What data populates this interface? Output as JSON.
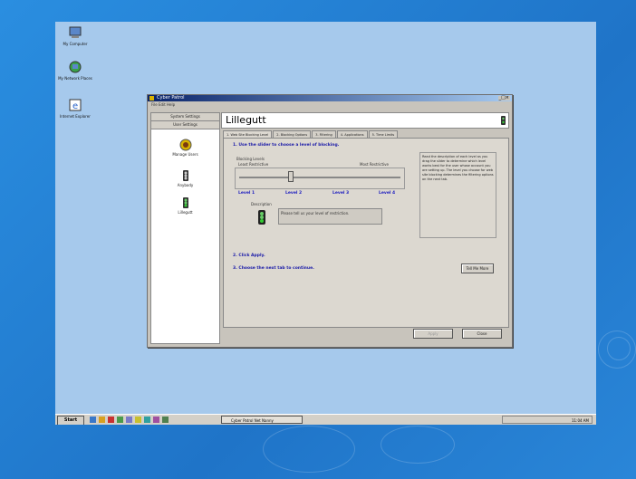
{
  "desktop": {
    "icons": [
      {
        "label": "My Computer",
        "icon": "computer-icon"
      },
      {
        "label": "My Network Places",
        "icon": "network-icon"
      },
      {
        "label": "Internet Explorer",
        "icon": "browser-icon"
      }
    ]
  },
  "window": {
    "title": "Cyber Patrol",
    "menu": "File  Edit  Help",
    "left_tabs": [
      "System Settings",
      "User Settings"
    ],
    "users": [
      {
        "label": "Manage Users",
        "icon": "manage-users-icon"
      },
      {
        "label": "Anybody",
        "icon": "traffic-light-icon"
      },
      {
        "label": "Lillegutt",
        "icon": "traffic-light-green-icon"
      }
    ],
    "selected_user": "Lillegutt",
    "tabs": [
      "1. Web Site Blocking Level",
      "2. Blocking Options",
      "3. Filtering",
      "4. Applications",
      "5. Time Limits"
    ],
    "content": {
      "step1": "1. Use the slider to choose a level of blocking.",
      "blocking_levels_label": "Blocking Levels",
      "least_restrictive": "Least Restrictive",
      "most_restrictive": "Most Restrictive",
      "levels": [
        "Level 1",
        "Level 2",
        "Level 3",
        "Level 4"
      ],
      "description_label": "Description",
      "description_text": "Please tell us your level of restriction.",
      "side_help": "Read the description of each level as you drag the slider to determine which level works best for the user whose account you are setting up. The level you choose for web site blocking determines the filtering options on the next tab.",
      "step2": "2. Click Apply.",
      "step3": "3. Choose the next tab to continue.",
      "tell_me_more": "Tell Me More"
    },
    "buttons": {
      "apply": "Apply",
      "close": "Close"
    }
  },
  "taskbar": {
    "start": "Start",
    "task": "Cyber Patrol Net Nanny",
    "clock": "11:04 AM"
  }
}
